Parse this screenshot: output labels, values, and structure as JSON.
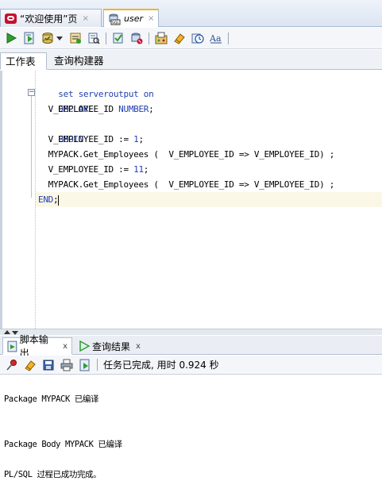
{
  "doc_tabs": [
    {
      "label": "“欢迎使用”页",
      "close": "×"
    },
    {
      "label": "user",
      "close": "×"
    }
  ],
  "toolbar_icons": [
    "run-statement-icon",
    "run-script-icon",
    "commit-icon",
    "autotrace-icon",
    "explain-plan-icon",
    "sql-tuning-icon",
    "rollback-icon",
    "unshared-sql-icon",
    "clear-icon",
    "history-icon",
    "format-icon"
  ],
  "sub_tabs": {
    "worksheet": "工作表",
    "query_builder": "查询构建器"
  },
  "code": {
    "line1": {
      "kw": "set serveroutput on"
    },
    "line2": {
      "kw": "DECLARE"
    },
    "line3": {
      "text": "  V_EMPLOYEE_ID ",
      "kw": "NUMBER",
      "end": ";"
    },
    "line4": {
      "kw": "BEGIN"
    },
    "line5": {
      "text": "  V_EMPLOYEE_ID := ",
      "num": "1",
      "end": ";"
    },
    "line6": {
      "text": "  MYPACK.Get_Employees (  V_EMPLOYEE_ID => V_EMPLOYEE_ID) ;"
    },
    "line7": {
      "text": "  V_EMPLOYEE_ID := ",
      "num": "11",
      "end": ";"
    },
    "line8": {
      "text": "  MYPACK.Get_Employees (  V_EMPLOYEE_ID => V_EMPLOYEE_ID) ;"
    },
    "line9": {
      "kw": "END",
      "end": ";"
    },
    "fold": "−"
  },
  "output_tabs": {
    "script_output": "脚本输出",
    "query_result": "查询结果",
    "close": "x"
  },
  "output_toolbar": {
    "status": "任务已完成, 用时 0.924 秒"
  },
  "output_lines": [
    "Package MYPACK 已编译",
    "Package Body MYPACK 已编译",
    "PL/SQL 过程已成功完成。"
  ]
}
